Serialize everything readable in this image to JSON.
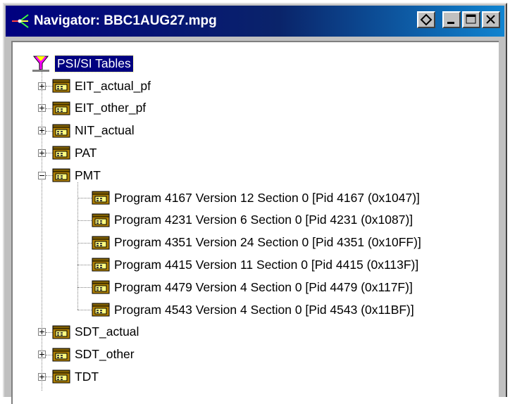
{
  "window": {
    "title": "Navigator: BBC1AUG27.mpg"
  },
  "tree": {
    "root": "PSI/SI Tables",
    "nodes": [
      {
        "label": "EIT_actual_pf",
        "expanded": false
      },
      {
        "label": "EIT_other_pf",
        "expanded": false
      },
      {
        "label": "NIT_actual",
        "expanded": false
      },
      {
        "label": "PAT",
        "expanded": false
      },
      {
        "label": "PMT",
        "expanded": true
      },
      {
        "label": "Program 4167 Version 12 Section 0 [Pid 4167 (0x1047)]",
        "child": true
      },
      {
        "label": "Program 4231 Version 6 Section 0 [Pid 4231 (0x1087)]",
        "child": true
      },
      {
        "label": "Program 4351 Version 24 Section 0 [Pid 4351 (0x10FF)]",
        "child": true
      },
      {
        "label": "Program 4415 Version 11 Section 0 [Pid 4415 (0x113F)]",
        "child": true
      },
      {
        "label": "Program 4479 Version 4 Section 0 [Pid 4479 (0x117F)]",
        "child": true
      },
      {
        "label": "Program 4543 Version 4 Section 0 [Pid 4543 (0x11BF)]",
        "child": true
      },
      {
        "label": "SDT_actual",
        "expanded": false
      },
      {
        "label": "SDT_other",
        "expanded": false
      },
      {
        "label": "TDT",
        "expanded": false
      }
    ]
  }
}
